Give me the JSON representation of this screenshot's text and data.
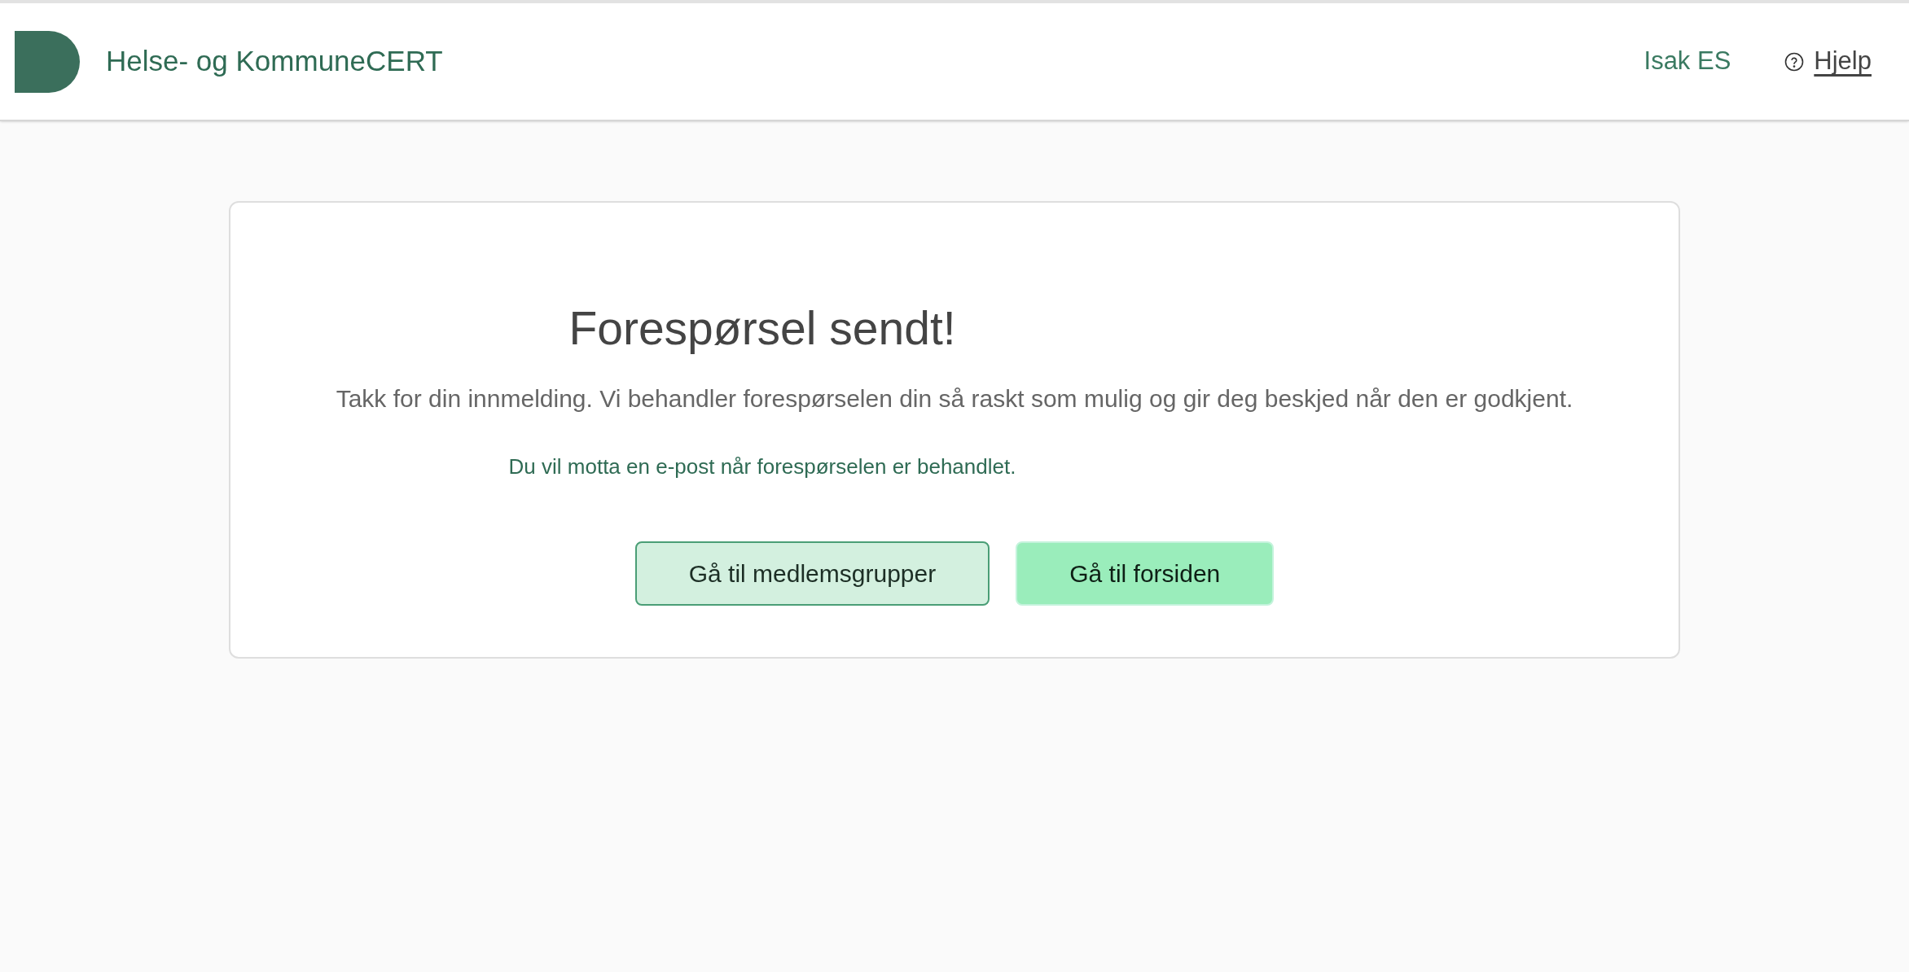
{
  "header": {
    "title": "Helse- og KommuneCERT",
    "user": "Isak ES",
    "help": "Hjelp"
  },
  "card": {
    "heading": "Forespørsel sendt!",
    "message": "Takk for din innmelding. Vi behandler forespørselen din så raskt som mulig og gir deg beskjed når den er godkjent.",
    "note": "Du vil motta en e-post når forespørselen er behandlet.",
    "buttons": [
      {
        "label": "Gå til medlemsgrupper",
        "kind": "secondary"
      },
      {
        "label": "Gå til forsiden",
        "kind": "primary"
      }
    ]
  }
}
